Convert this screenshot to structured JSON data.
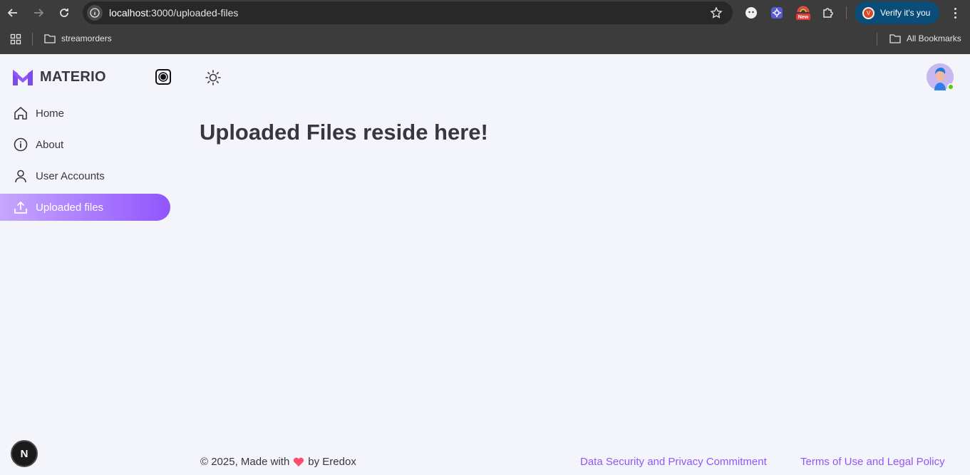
{
  "browser": {
    "url_host": "localhost",
    "url_rest": ":3000/uploaded-files",
    "profile_label": "Verify it's you",
    "ext_badge": "New",
    "bookmarks": [
      {
        "label": "streamorders"
      }
    ],
    "all_bookmarks_label": "All Bookmarks"
  },
  "app": {
    "logo_text": "MATERIO",
    "nav": [
      {
        "label": "Home",
        "icon": "home-icon",
        "active": false
      },
      {
        "label": "About",
        "icon": "info-icon",
        "active": false
      },
      {
        "label": "User Accounts",
        "icon": "user-icon",
        "active": false
      },
      {
        "label": "Uploaded files",
        "icon": "upload-icon",
        "active": true
      }
    ],
    "page_title": "Uploaded Files reside here!",
    "footer": {
      "made_prefix": "© 2025, Made with",
      "made_suffix": "by Eredox",
      "link_privacy": "Data Security and Privacy Commitment",
      "link_terms": "Terms of Use and Legal Policy"
    },
    "next_badge": "N",
    "colors": {
      "primary": "#9155fd",
      "text": "#3a3541",
      "background": "#f4f5fa",
      "online": "#56ca00"
    }
  }
}
